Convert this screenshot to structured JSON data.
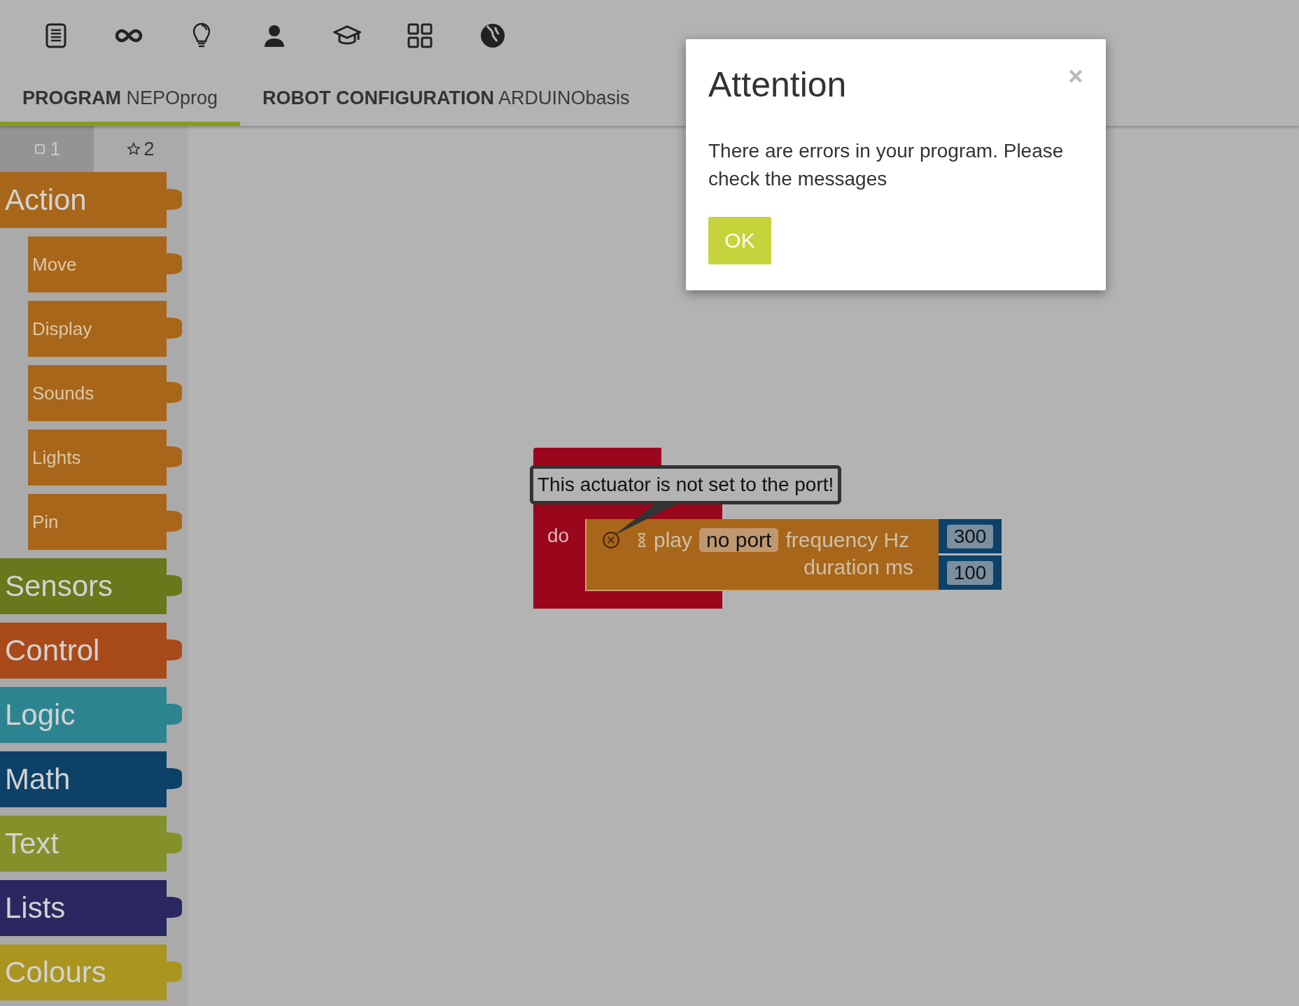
{
  "tabs": [
    {
      "label": "PROGRAM",
      "name": "NEPOprog",
      "selected": true
    },
    {
      "label": "ROBOT CONFIGURATION",
      "name": "ARDUINObasis",
      "selected": false
    }
  ],
  "toolbox_levels": [
    {
      "kind": "square",
      "label": "1",
      "selected": true
    },
    {
      "kind": "star",
      "label": "2",
      "selected": false
    }
  ],
  "categories": [
    {
      "label": "Action",
      "color": "#a8661a",
      "children": [
        {
          "label": "Move"
        },
        {
          "label": "Display"
        },
        {
          "label": "Sounds"
        },
        {
          "label": "Lights"
        },
        {
          "label": "Pin"
        }
      ]
    },
    {
      "label": "Sensors",
      "color": "#68781a"
    },
    {
      "label": "Control",
      "color": "#a84a1a"
    },
    {
      "label": "Logic",
      "color": "#2b8490"
    },
    {
      "label": "Math",
      "color": "#0d4168"
    },
    {
      "label": "Text",
      "color": "#84902a"
    },
    {
      "label": "Lists",
      "color": "#2b2760"
    },
    {
      "label": "Colours",
      "color": "#aa9520"
    }
  ],
  "workspace": {
    "do_label": "do",
    "tooltip": "This actuator is not set to the port!",
    "play_block": {
      "error": true,
      "label": "play",
      "port": "no port",
      "frequency_label": "frequency Hz",
      "frequency": "300",
      "duration_label": "duration ms",
      "duration": "100"
    }
  },
  "dialog": {
    "title": "Attention",
    "message": "There are errors in your program. Please check the messages",
    "button": "OK"
  }
}
